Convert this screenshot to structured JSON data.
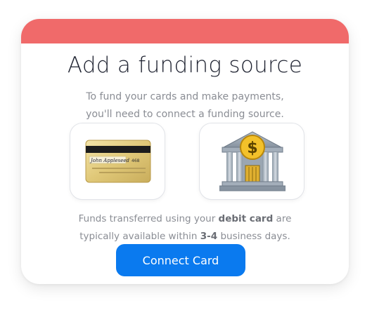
{
  "dialog": {
    "title": "Add a funding source",
    "subtitle_line1": "To fund your cards and make payments,",
    "subtitle_line2": "you'll need to connect a funding source.",
    "options": [
      {
        "icon": "credit-card-icon",
        "card_signature": "John Appleseed",
        "card_cvv": "468"
      },
      {
        "icon": "bank-icon",
        "symbol": "$"
      }
    ],
    "note": {
      "line1_pre": "Funds transferred using your ",
      "line1_bold": "debit card",
      "line1_post": " are",
      "line2_pre": "typically available within ",
      "line2_bold": "3-4",
      "line2_post": " business days."
    },
    "connect_label": "Connect Card"
  },
  "colors": {
    "header": "#f06a6a",
    "button": "#0a7aef"
  }
}
